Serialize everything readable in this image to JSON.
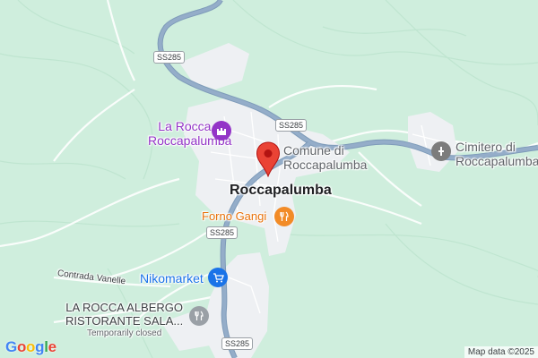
{
  "map": {
    "town": "Roccapalumba",
    "places": {
      "castle": "La Rocca a Roccapalumba",
      "castle_line1": "La Rocca a",
      "castle_line2": "Roccapalumba",
      "comune_line1": "Comune di",
      "comune_line2": "Roccapalumba",
      "cemetery_line1": "Cimitero di",
      "cemetery_line2": "Roccapalumba",
      "bakery": "Forno Gangi",
      "shop": "Nikomarket",
      "restaurant_line1": "LA ROCCA ALBERGO",
      "restaurant_line2": "RISTORANTE SALA...",
      "restaurant_status": "Temporarily closed"
    },
    "road": {
      "name": "SS285",
      "local": "Contrada Vanelle"
    },
    "logo": [
      "G",
      "o",
      "o",
      "g",
      "l",
      "e"
    ],
    "attribution": "Map data ©2025"
  },
  "colors": {
    "terrain": "#cfeedd",
    "urban": "#eef0f3",
    "highway": "#8ba6c4",
    "pin": "#ea4335",
    "poi_purple": "#9334c7",
    "poi_orange": "#f28b27",
    "poi_blue": "#1a73e8",
    "poi_grey": "#7c7c7c"
  },
  "icons": [
    "map-pin-icon",
    "castle-icon",
    "monument-icon",
    "restaurant-icon",
    "shopping-cart-icon"
  ]
}
